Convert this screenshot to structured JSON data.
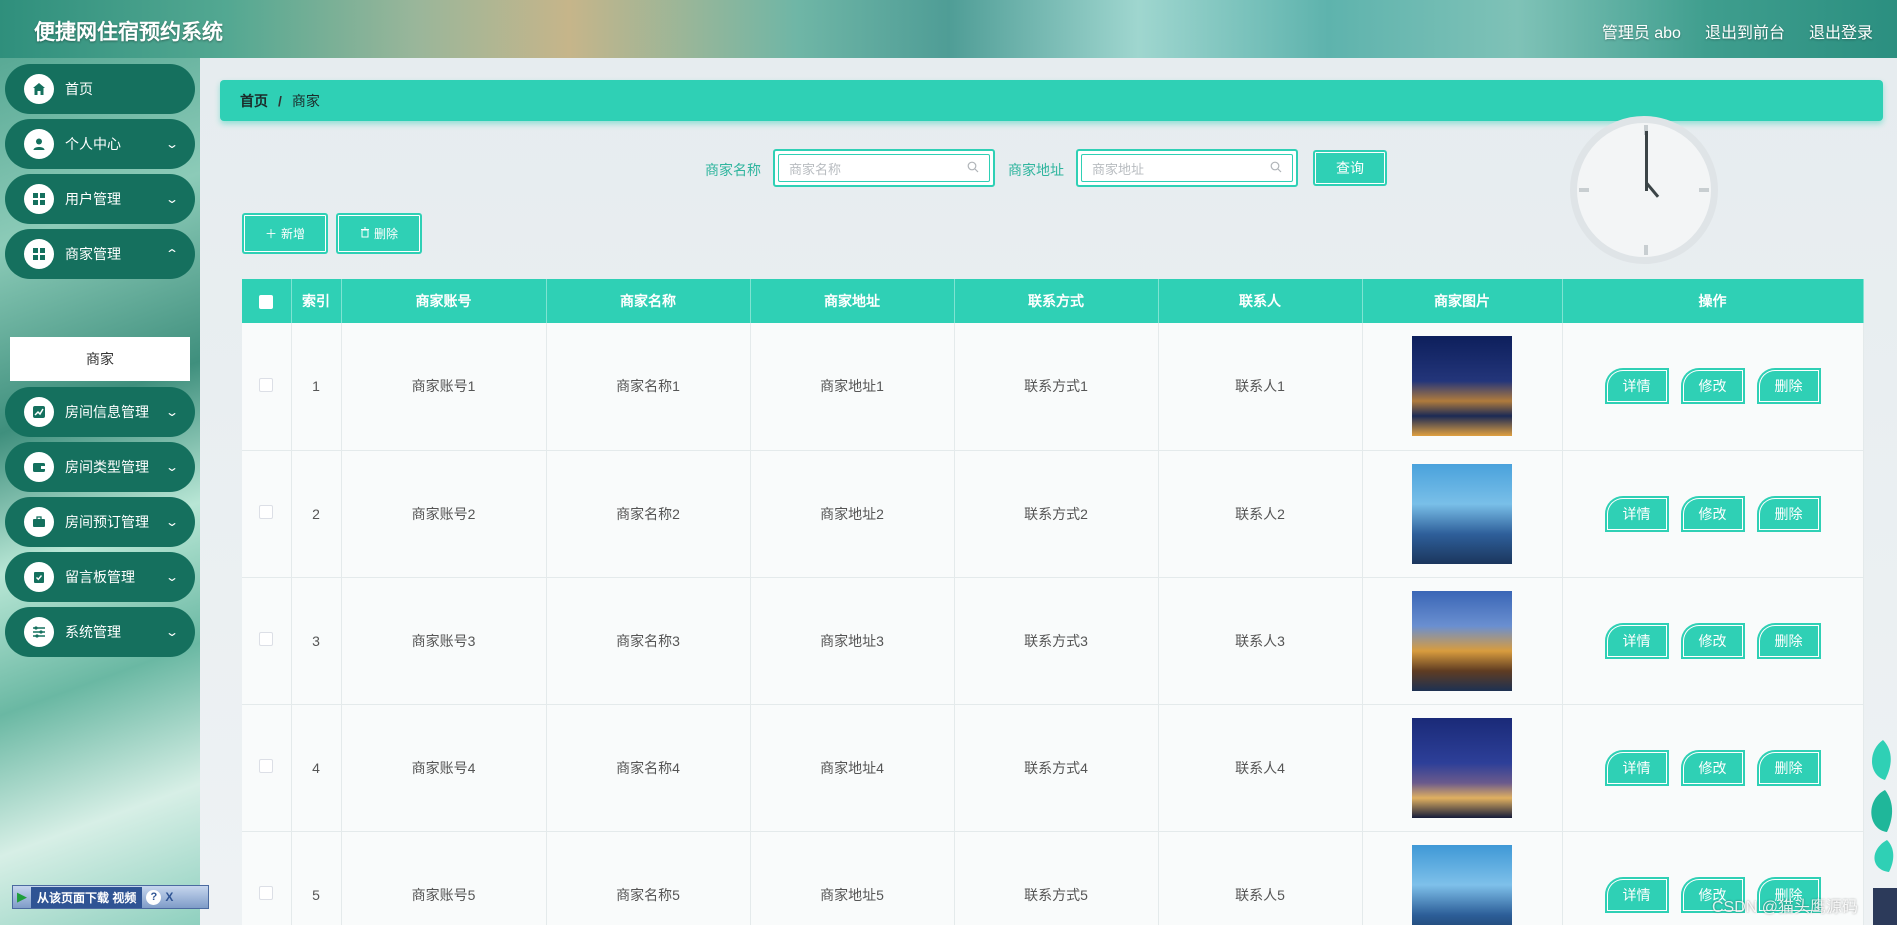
{
  "header": {
    "title": "便捷网住宿预约系统",
    "admin": "管理员 abo",
    "frontend_link": "退出到前台",
    "logout_link": "退出登录"
  },
  "sidebar": {
    "items": [
      {
        "label": "首页",
        "icon": "home-icon"
      },
      {
        "label": "个人中心",
        "icon": "user-icon"
      },
      {
        "label": "用户管理",
        "icon": "grid-icon"
      },
      {
        "label": "商家管理",
        "icon": "grid-icon"
      },
      {
        "label": "房间信息管理",
        "icon": "chart-icon"
      },
      {
        "label": "房间类型管理",
        "icon": "wallet-icon"
      },
      {
        "label": "房间预订管理",
        "icon": "briefcase-icon"
      },
      {
        "label": "留言板管理",
        "icon": "clipboard-icon"
      },
      {
        "label": "系统管理",
        "icon": "sliders-icon"
      }
    ],
    "sub_item": "商家"
  },
  "breadcrumb": {
    "home": "首页",
    "sep": "/",
    "current": "商家"
  },
  "search": {
    "name_label": "商家名称",
    "name_placeholder": "商家名称",
    "address_label": "商家地址",
    "address_placeholder": "商家地址",
    "query_button": "查询"
  },
  "actions": {
    "add": "新增",
    "delete": "删除"
  },
  "table": {
    "headers": [
      "索引",
      "商家账号",
      "商家名称",
      "商家地址",
      "联系方式",
      "联系人",
      "商家图片",
      "操作"
    ],
    "rows": [
      {
        "index": "1",
        "account": "商家账号1",
        "name": "商家名称1",
        "address": "商家地址1",
        "contact": "联系方式1",
        "person": "联系人1"
      },
      {
        "index": "2",
        "account": "商家账号2",
        "name": "商家名称2",
        "address": "商家地址2",
        "contact": "联系方式2",
        "person": "联系人2"
      },
      {
        "index": "3",
        "account": "商家账号3",
        "name": "商家名称3",
        "address": "商家地址3",
        "contact": "联系方式3",
        "person": "联系人3"
      },
      {
        "index": "4",
        "account": "商家账号4",
        "name": "商家名称4",
        "address": "商家地址4",
        "contact": "联系方式4",
        "person": "联系人4"
      },
      {
        "index": "5",
        "account": "商家账号5",
        "name": "商家名称5",
        "address": "商家地址5",
        "contact": "联系方式5",
        "person": "联系人5"
      }
    ],
    "row_buttons": {
      "detail": "详情",
      "edit": "修改",
      "delete": "删除"
    }
  },
  "download_bar": {
    "label": "从该页面下载 视频",
    "help": "?",
    "close": "X"
  },
  "watermark": "CSDN @猫头鹰源码",
  "colors": {
    "accent": "#2fd0b5",
    "sidebar_item": "#15705e"
  }
}
